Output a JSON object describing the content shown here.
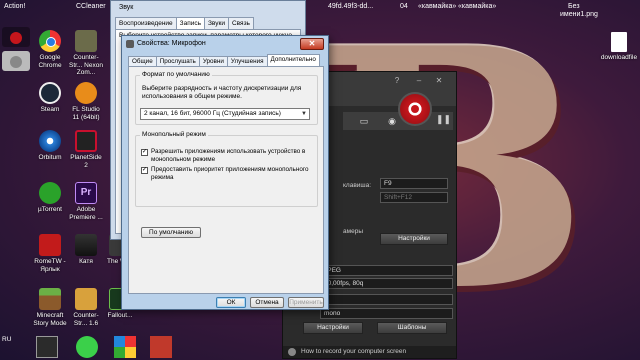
{
  "desktop": {
    "top_labels": [
      {
        "text": "Action!"
      },
      {
        "text": "CCleaner"
      },
      {
        "text": "49fd.49f3-dd..."
      },
      {
        "text": "04"
      },
      {
        "text": "«кавмайка»"
      },
      {
        "text": "«кавмайка»"
      },
      {
        "text": "Без"
      },
      {
        "text": "имени1.png"
      }
    ],
    "icons": [
      {
        "label": "Google Chrome",
        "icon": "chrome-icon"
      },
      {
        "label": "Counter-Str... Nexon Zom...",
        "icon": "cs-nexon-icon"
      },
      {
        "label": "Steam",
        "icon": "steam-icon"
      },
      {
        "label": "FL Studio 11 (64bit)",
        "icon": "fl-studio-icon"
      },
      {
        "label": "Orbitum",
        "icon": "orbitum-icon"
      },
      {
        "label": "PlanetSide 2",
        "icon": "planetside-icon"
      },
      {
        "label": "µTorrent",
        "icon": "utorrent-icon"
      },
      {
        "label": "Adobe Premiere ...",
        "icon": "premiere-icon"
      },
      {
        "label": "RomeTW - Ярлык",
        "icon": "rome-icon"
      },
      {
        "label": "Катя",
        "icon": "folder-icon"
      },
      {
        "label": "The Wi...",
        "icon": "game-icon"
      },
      {
        "label": "Minecraft Story Mode",
        "icon": "minecraft-icon"
      },
      {
        "label": "Counter-Str... 1.6",
        "icon": "cs16-icon"
      },
      {
        "label": "Fallout...",
        "icon": "fallout-icon"
      },
      {
        "label": "downloadfile",
        "icon": "document-icon"
      }
    ],
    "language": "RU"
  },
  "sound_dialog": {
    "title": "Звук",
    "tabs": [
      "Воспроизведение",
      "Запись",
      "Звуки",
      "Связь"
    ],
    "active_tab": "Запись",
    "hint": "Выберите устройство записи, параметры которого нужно"
  },
  "mic_dialog": {
    "title": "Свойства: Микрофон",
    "close_label": "✕",
    "tabs": [
      "Общие",
      "Прослушать",
      "Уровни",
      "Улучшения",
      "Дополнительно"
    ],
    "active_tab": "Дополнительно",
    "default_format": {
      "group_title": "Формат по умолчанию",
      "description": "Выберите разрядность и частоту дискретизации для использования в общем режиме.",
      "selected": "2 канал, 16 бит, 96000 Гц (Студийная запись)"
    },
    "exclusive": {
      "group_title": "Монопольный режим",
      "option1": "Разрешить приложениям использовать устройство в монопольном режиме",
      "option1_checked": true,
      "option2": "Предоставить приоритет приложениям монопольного режима",
      "option2_checked": true
    },
    "default_button": "По умолчанию",
    "ok_button": "ОК",
    "cancel_button": "Отмена",
    "apply_button": "Применить"
  },
  "recorder": {
    "hotkey_label": "клавиша:",
    "hotkey_value": "F9",
    "hotkey2_value": "Shift+F12",
    "camera_label": "амеры",
    "settings1_label": "Настройки",
    "format_value": "JPEG",
    "quality_value": "30,00fps, 80q",
    "audio_value": "mono",
    "settings2_label": "Настройки",
    "templates_label": "Шаблоны",
    "footer_text": "How to record your computer screen",
    "controls": [
      "?",
      "–",
      "✕"
    ]
  },
  "colors": {
    "record_red": "#c5161c",
    "dialog_blue": "#b9d1ea",
    "close_red": "#c43b21"
  }
}
